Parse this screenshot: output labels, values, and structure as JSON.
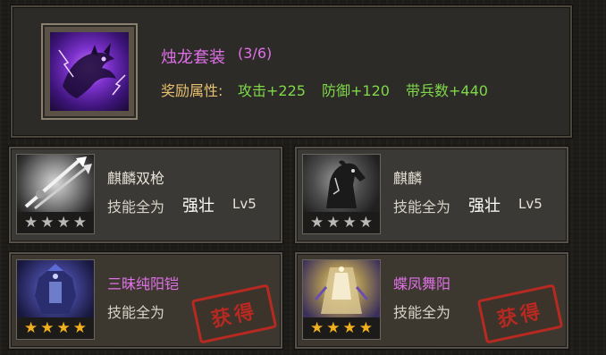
{
  "set": {
    "name": "烛龙套装",
    "count": "(3/6)",
    "attr_label": "奖励属性:",
    "attack": "攻击+225",
    "defense": "防御+120",
    "troops": "带兵数+440",
    "icon": "purple-dragon-icon"
  },
  "items": [
    {
      "name": "麒麟双枪",
      "skill_label": "技能全为",
      "skill_value": "强壮",
      "level": "Lv5",
      "stars": 4,
      "star_color": "grey",
      "icon": "twin-spear-icon",
      "obtained": false
    },
    {
      "name": "麒麟",
      "skill_label": "技能全为",
      "skill_value": "强壮",
      "level": "Lv5",
      "stars": 4,
      "star_color": "grey",
      "icon": "horse-icon",
      "obtained": false
    },
    {
      "name": "三昧纯阳铠",
      "skill_label": "技能全为",
      "skill_value": "",
      "level": "",
      "stars": 4,
      "star_color": "gold",
      "icon": "armor-icon",
      "obtained": true,
      "stamp_text": "获得"
    },
    {
      "name": "蝶凤舞阳",
      "skill_label": "技能全为",
      "skill_value": "",
      "level": "",
      "stars": 4,
      "star_color": "gold",
      "icon": "cape-icon",
      "obtained": true,
      "stamp_text": "获得"
    }
  ],
  "colors": {
    "set_name": "#e070e8",
    "attr_label": "#e8c070",
    "attr_value": "#7fd84a",
    "stamp": "#c22820"
  }
}
